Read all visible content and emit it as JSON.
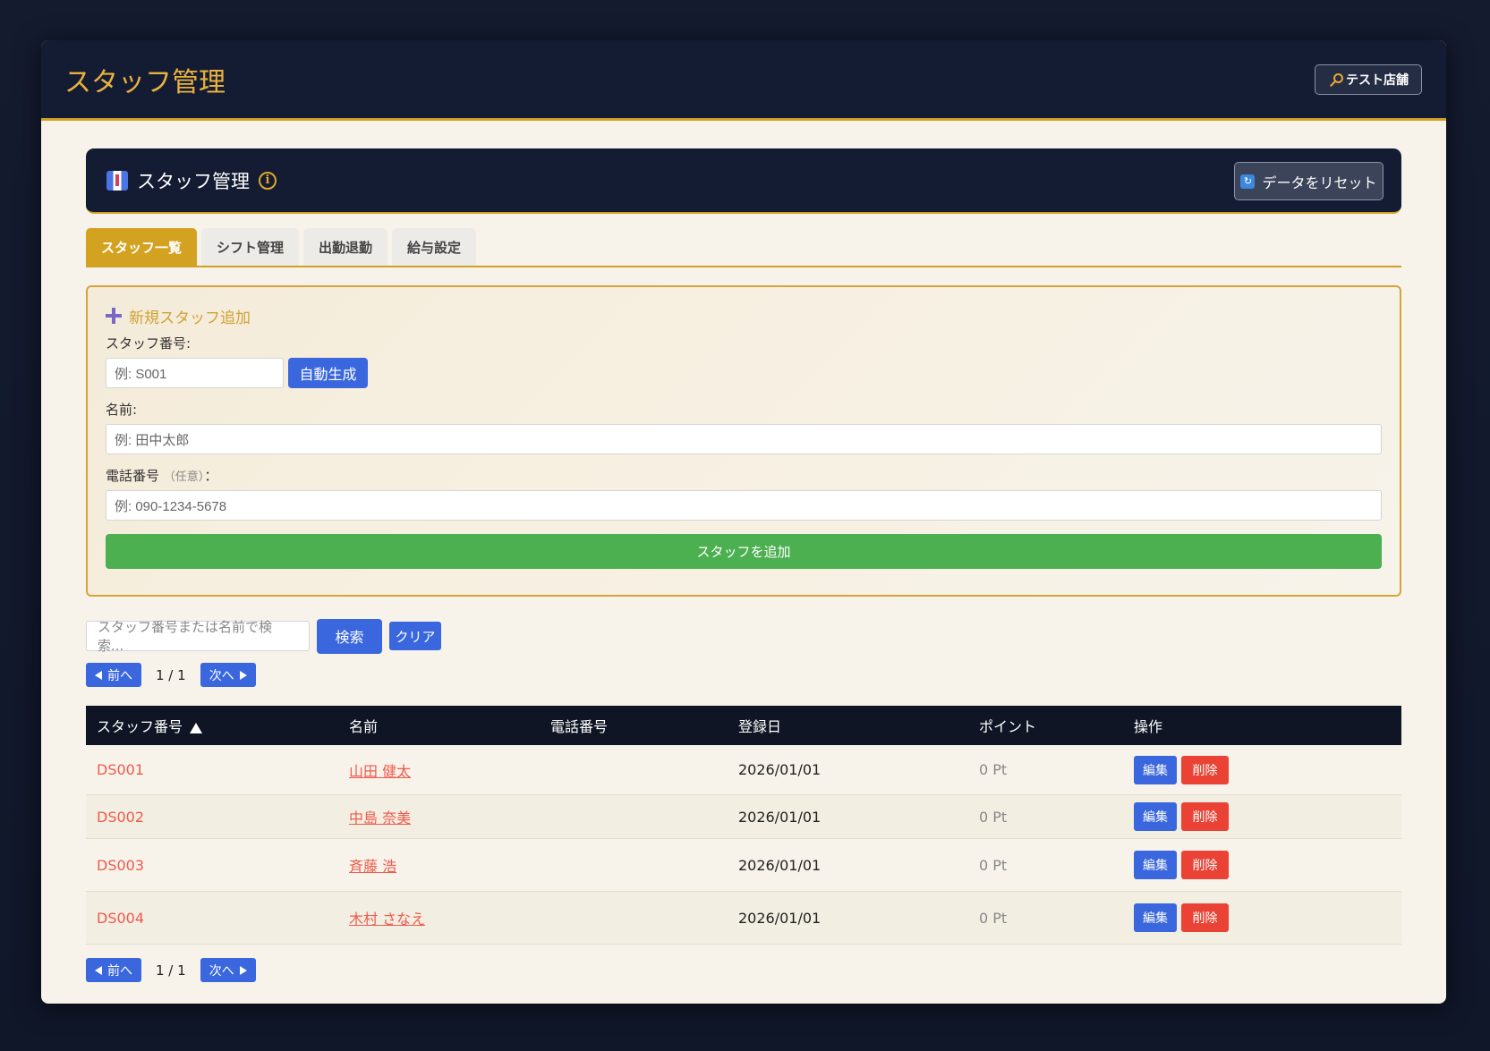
{
  "app": {
    "title": "スタッフ管理",
    "store_label": "テスト店舗"
  },
  "section": {
    "title": "スタッフ管理",
    "info": "i",
    "reset_label": "データをリセット"
  },
  "tabs": [
    {
      "label": "スタッフ一覧",
      "active": true
    },
    {
      "label": "シフト管理",
      "active": false
    },
    {
      "label": "出勤退勤",
      "active": false
    },
    {
      "label": "給与設定",
      "active": false
    }
  ],
  "form": {
    "heading": "新規スタッフ追加",
    "staff_no_label": "スタッフ番号:",
    "staff_no_placeholder": "例: S001",
    "autogen_label": "自動生成",
    "name_label": "名前:",
    "name_placeholder": "例: 田中太郎",
    "phone_label": "電話番号",
    "phone_optional": "（任意）",
    "phone_colon": "：",
    "phone_placeholder": "例: 090-1234-5678",
    "submit_label": "スタッフを追加"
  },
  "search": {
    "placeholder": "スタッフ番号または名前で検索...",
    "search_label": "検索",
    "clear_label": "クリア"
  },
  "pager": {
    "prev_label": "前へ",
    "next_label": "次へ",
    "page_text": "1 / 1"
  },
  "table": {
    "headers": [
      "スタッフ番号",
      "名前",
      "電話番号",
      "登録日",
      "ポイント",
      "操作"
    ],
    "sort_column": "スタッフ番号",
    "sort_direction": "asc",
    "rows": [
      {
        "id": "DS001",
        "name": "山田 健太",
        "phone": "",
        "date": "2026/01/01",
        "points": "0 Pt"
      },
      {
        "id": "DS002",
        "name": "中島 奈美",
        "phone": "",
        "date": "2026/01/01",
        "points": "0 Pt"
      },
      {
        "id": "DS003",
        "name": "斉藤 浩",
        "phone": "",
        "date": "2026/01/01",
        "points": "0 Pt"
      },
      {
        "id": "DS004",
        "name": "木村 さなえ",
        "phone": "",
        "date": "2026/01/01",
        "points": "0 Pt"
      }
    ],
    "edit_label": "編集",
    "delete_label": "削除"
  },
  "colors": {
    "accent": "#d1a123",
    "primary": "#3a67de",
    "danger": "#ea4335",
    "success": "#4caf50",
    "header_bg": "#141c33"
  }
}
